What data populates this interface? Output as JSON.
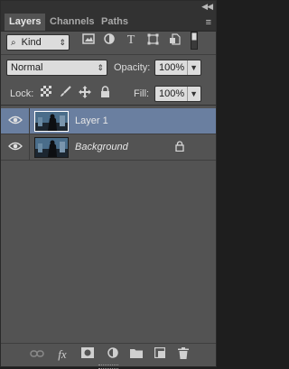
{
  "tabs": [
    {
      "label": "Layers",
      "active": true
    },
    {
      "label": "Channels",
      "active": false
    },
    {
      "label": "Paths",
      "active": false
    }
  ],
  "panel_menu_icon": "menu-icon",
  "collapse_icon": "double-chevron-icon",
  "filter": {
    "kind_label": "Kind",
    "icons": [
      "search-icon",
      "image-icon",
      "adjustment-icon",
      "type-icon",
      "shape-icon",
      "smart-object-icon",
      "toggle-icon"
    ]
  },
  "blend": {
    "mode": "Normal",
    "opacity_label": "Opacity:",
    "opacity_value": "100%"
  },
  "lock": {
    "label": "Lock:",
    "icons": [
      "checker-icon",
      "brush-icon",
      "move-icon",
      "lock-icon"
    ],
    "fill_label": "Fill:",
    "fill_value": "100%"
  },
  "layers": [
    {
      "name": "Layer 1",
      "selected": true,
      "visible": true,
      "locked": false,
      "italic": false
    },
    {
      "name": "Background",
      "selected": false,
      "visible": true,
      "locked": true,
      "italic": true
    }
  ],
  "bottom_icons": [
    "link-icon",
    "fx-icon",
    "mask-icon",
    "adjustment-layer-icon",
    "group-folder-icon",
    "new-layer-icon",
    "trash-icon"
  ],
  "colors": {
    "panel_bg": "#535353",
    "tab_bar": "#323232",
    "selection": "#6a7fa0"
  }
}
